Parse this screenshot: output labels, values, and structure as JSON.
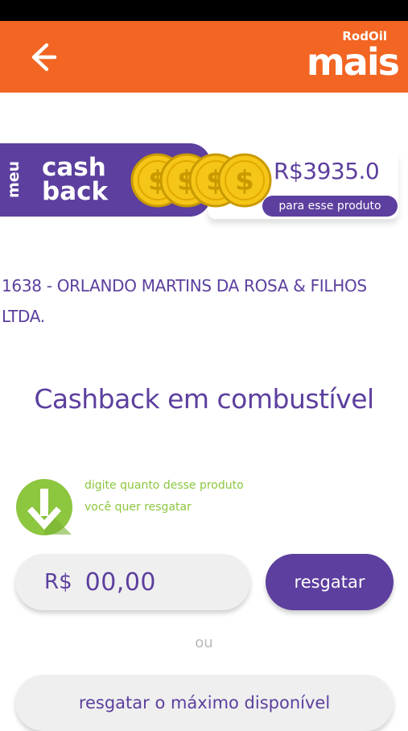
{
  "header": {
    "back_icon": "arrow-left-icon",
    "brand_top": "RodOil",
    "brand_word": "mais"
  },
  "cashback": {
    "label_meu": "meu",
    "label_line1": "cash",
    "label_line2": "back",
    "coins_icon": "coins-icon",
    "value": "R$3935.0",
    "subtitle": "para esse produto"
  },
  "station": {
    "name": "1638 - ORLANDO MARTINS DA ROSA & FILHOS LTDA."
  },
  "section": {
    "title": "Cashback em combustível"
  },
  "hint": {
    "icon": "arrow-down-icon",
    "text": "digite quanto desse produto você quer resgatar"
  },
  "redeem": {
    "currency": "R$",
    "amount": "00,00",
    "button_label": "resgatar",
    "or_label": "ou",
    "max_label": "resgatar o máximo disponível"
  },
  "colors": {
    "header": "#f26522",
    "primary": "#5c3f9e",
    "hint": "#8dc63f",
    "coin": "#f5c518"
  }
}
